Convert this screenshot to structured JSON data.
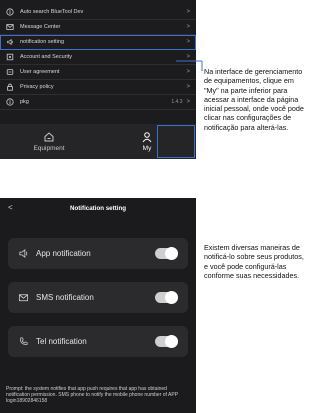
{
  "screen1": {
    "menu": [
      {
        "label": "Auto search BlueTool Dev",
        "icon": "info-icon",
        "chevron": ">"
      },
      {
        "label": "Message Center",
        "icon": "mail-icon",
        "chevron": ">"
      },
      {
        "label": "notification setting",
        "icon": "speaker-icon",
        "chevron": ">",
        "highlighted": true
      },
      {
        "label": "Account and Security",
        "icon": "shield-icon",
        "chevron": ">"
      },
      {
        "label": "User agreement",
        "icon": "document-icon",
        "chevron": ">"
      },
      {
        "label": "Privacy policy",
        "icon": "lock-icon",
        "chevron": ">"
      },
      {
        "label": "pkg",
        "icon": "info-icon",
        "chevron": ">",
        "value": "1.4.3"
      }
    ],
    "nav": {
      "equipment_label": "Equipment",
      "my_label": "My"
    }
  },
  "annotation1": "Na interface de gerenciamento de equipamentos, clique em \"My\" na parte inferior para acessar a interface da página inicial pessoal, onde você pode clicar nas configurações de notificação para alterá-las.",
  "screen2": {
    "title": "Notification setting",
    "back": "<",
    "items": [
      {
        "label": "App notification",
        "icon": "speaker-icon",
        "enabled": true
      },
      {
        "label": "SMS notification",
        "icon": "mail-icon",
        "enabled": true
      },
      {
        "label": "Tel notification",
        "icon": "phone-icon",
        "enabled": true
      }
    ],
    "prompt": "Prompt: the system notifies that app push requires that app has obtained notification permission. SMS phone to notify the mobile phone number of APP login18902846158"
  },
  "annotation2": "Existem diversas maneiras de notificá-lo sobre seus produtos, e você pode configurá-las conforme suas necessidades."
}
